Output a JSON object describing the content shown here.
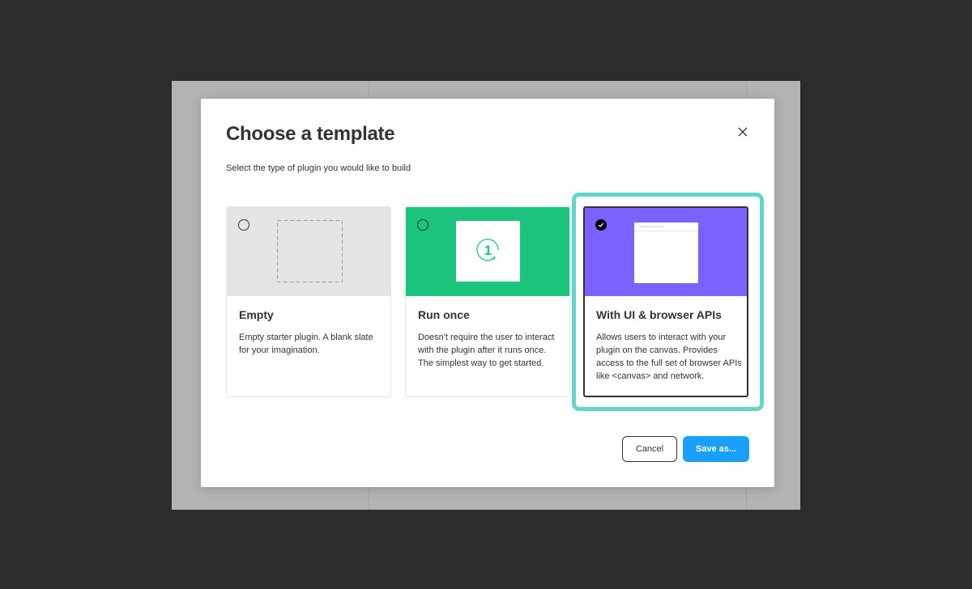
{
  "dialog": {
    "title": "Choose a template",
    "subtitle": "Select the type of plugin you would like to build",
    "close_icon": "close-icon"
  },
  "templates": [
    {
      "title": "Empty",
      "description": "Empty starter plugin. A blank slate for your imagination.",
      "preview_color": "#e5e5e5",
      "selected": false
    },
    {
      "title": "Run once",
      "description": "Doesn't require the user to interact with the plugin after it runs once. The simplest way to get started.",
      "preview_color": "#1bc47d",
      "preview_badge": "1",
      "selected": false
    },
    {
      "title": "With UI & browser APIs",
      "description": "Allows users to interact with your plugin on the canvas. Provides access to the full set of browser APIs like <canvas> and network.",
      "preview_color": "#7b61ff",
      "selected": true
    }
  ],
  "actions": {
    "cancel_label": "Cancel",
    "save_label": "Save as..."
  },
  "colors": {
    "accent": "#18a0fb",
    "highlight": "#5ed7c9",
    "backdrop": "#2c2c2c"
  }
}
